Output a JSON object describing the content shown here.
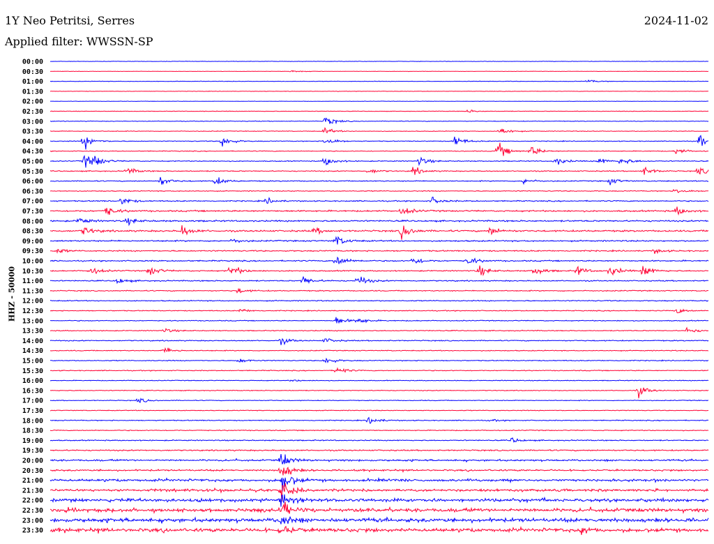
{
  "header": {
    "station": "1Y Neo Petritsi, Serres",
    "date": "2024-11-02",
    "filter": "Applied filter: WWSSN-SP"
  },
  "chart_data": {
    "type": "line",
    "title": "1Y Neo Petritsi, Serres",
    "ylabel": "HHZ - 50000",
    "xlabel": "",
    "minutes_per_line": 30,
    "colors": [
      "#0000ff",
      "#ff0033"
    ],
    "tick_labels": [
      "00:00",
      "00:30",
      "01:00",
      "01:30",
      "02:00",
      "02:30",
      "03:00",
      "03:30",
      "04:00",
      "04:30",
      "05:00",
      "05:30",
      "06:00",
      "06:30",
      "07:00",
      "07:30",
      "08:00",
      "08:30",
      "09:00",
      "09:30",
      "10:00",
      "10:30",
      "11:00",
      "11:30",
      "12:00",
      "12:30",
      "13:00",
      "13:30",
      "14:00",
      "14:30",
      "15:00",
      "15:30",
      "16:00",
      "16:30",
      "17:00",
      "17:30",
      "18:00",
      "18:30",
      "19:00",
      "19:30",
      "20:00",
      "20:30",
      "21:00",
      "21:30",
      "22:00",
      "22:30",
      "23:00",
      "23:30"
    ],
    "noise_level": [
      0.3,
      0.3,
      0.4,
      0.3,
      0.3,
      0.4,
      0.5,
      0.5,
      0.6,
      0.6,
      0.7,
      0.8,
      0.8,
      0.7,
      0.9,
      1.2,
      1.2,
      1.3,
      1.1,
      1.0,
      1.0,
      0.9,
      0.9,
      0.8,
      0.8,
      0.7,
      0.7,
      0.7,
      0.8,
      0.7,
      0.7,
      0.7,
      0.6,
      0.6,
      0.6,
      0.6,
      0.7,
      0.7,
      0.8,
      1.0,
      1.3,
      1.2,
      1.8,
      1.8,
      2.2,
      2.6,
      2.8,
      2.6
    ],
    "events": [
      [
        1,
        11.0,
        2
      ],
      [
        2,
        24.5,
        3
      ],
      [
        5,
        19.0,
        3
      ],
      [
        6,
        12.5,
        10
      ],
      [
        7,
        12.5,
        6
      ],
      [
        7,
        20.5,
        8
      ],
      [
        8,
        1.5,
        14
      ],
      [
        8,
        7.8,
        12
      ],
      [
        8,
        12.5,
        10
      ],
      [
        8,
        18.4,
        10
      ],
      [
        8,
        29.5,
        12
      ],
      [
        9,
        20.4,
        14
      ],
      [
        9,
        21.9,
        10
      ],
      [
        9,
        28.5,
        6
      ],
      [
        10,
        1.5,
        12
      ],
      [
        10,
        2.0,
        10
      ],
      [
        10,
        12.5,
        10
      ],
      [
        10,
        16.8,
        8
      ],
      [
        10,
        23.0,
        8
      ],
      [
        10,
        25.0,
        6
      ],
      [
        10,
        26.0,
        8
      ],
      [
        11,
        3.5,
        6
      ],
      [
        11,
        14.5,
        5
      ],
      [
        11,
        16.5,
        8
      ],
      [
        11,
        27.0,
        8
      ],
      [
        11,
        29.5,
        8
      ],
      [
        12,
        5.0,
        8
      ],
      [
        12,
        7.5,
        8
      ],
      [
        12,
        21.5,
        6
      ],
      [
        12,
        25.5,
        6
      ],
      [
        13,
        28.5,
        6
      ],
      [
        14,
        3.2,
        8
      ],
      [
        14,
        9.8,
        6
      ],
      [
        14,
        17.4,
        6
      ],
      [
        15,
        2.5,
        10
      ],
      [
        15,
        16.0,
        8
      ],
      [
        15,
        28.5,
        8
      ],
      [
        16,
        1.3,
        6
      ],
      [
        16,
        3.5,
        6
      ],
      [
        17,
        1.5,
        8
      ],
      [
        17,
        6.0,
        10
      ],
      [
        17,
        12.0,
        6
      ],
      [
        17,
        16.0,
        14
      ],
      [
        17,
        20.0,
        8
      ],
      [
        18,
        8.3,
        4
      ],
      [
        18,
        13.0,
        10
      ],
      [
        19,
        0.3,
        4
      ],
      [
        19,
        27.5,
        4
      ],
      [
        20,
        13.0,
        12
      ],
      [
        20,
        16.5,
        8
      ],
      [
        20,
        19.0,
        8
      ],
      [
        21,
        1.8,
        8
      ],
      [
        21,
        4.5,
        10
      ],
      [
        21,
        8.2,
        12
      ],
      [
        21,
        19.5,
        10
      ],
      [
        21,
        22.0,
        10
      ],
      [
        21,
        24.0,
        8
      ],
      [
        21,
        25.5,
        10
      ],
      [
        21,
        27.0,
        12
      ],
      [
        22,
        3.0,
        6
      ],
      [
        22,
        11.5,
        8
      ],
      [
        22,
        14.0,
        10
      ],
      [
        23,
        8.5,
        5
      ],
      [
        25,
        8.6,
        4
      ],
      [
        25,
        28.5,
        6
      ],
      [
        26,
        13.0,
        8
      ],
      [
        26,
        14.0,
        6
      ],
      [
        27,
        5.2,
        4
      ],
      [
        27,
        29.0,
        6
      ],
      [
        28,
        10.5,
        6
      ],
      [
        28,
        12.5,
        5
      ],
      [
        29,
        5.2,
        6
      ],
      [
        30,
        8.6,
        4
      ],
      [
        30,
        12.5,
        8
      ],
      [
        31,
        13.0,
        8
      ],
      [
        32,
        11.0,
        2
      ],
      [
        33,
        26.8,
        10
      ],
      [
        34,
        4.0,
        5
      ],
      [
        36,
        14.5,
        8
      ],
      [
        36,
        20.0,
        2
      ],
      [
        38,
        21.0,
        5
      ],
      [
        40,
        10.5,
        12
      ],
      [
        41,
        10.5,
        18
      ],
      [
        42,
        10.5,
        22
      ],
      [
        43,
        10.5,
        18
      ],
      [
        44,
        10.5,
        16
      ],
      [
        45,
        10.5,
        14
      ],
      [
        46,
        10.5,
        12
      ],
      [
        47,
        10.5,
        10
      ],
      [
        47,
        24.2,
        6
      ]
    ]
  }
}
